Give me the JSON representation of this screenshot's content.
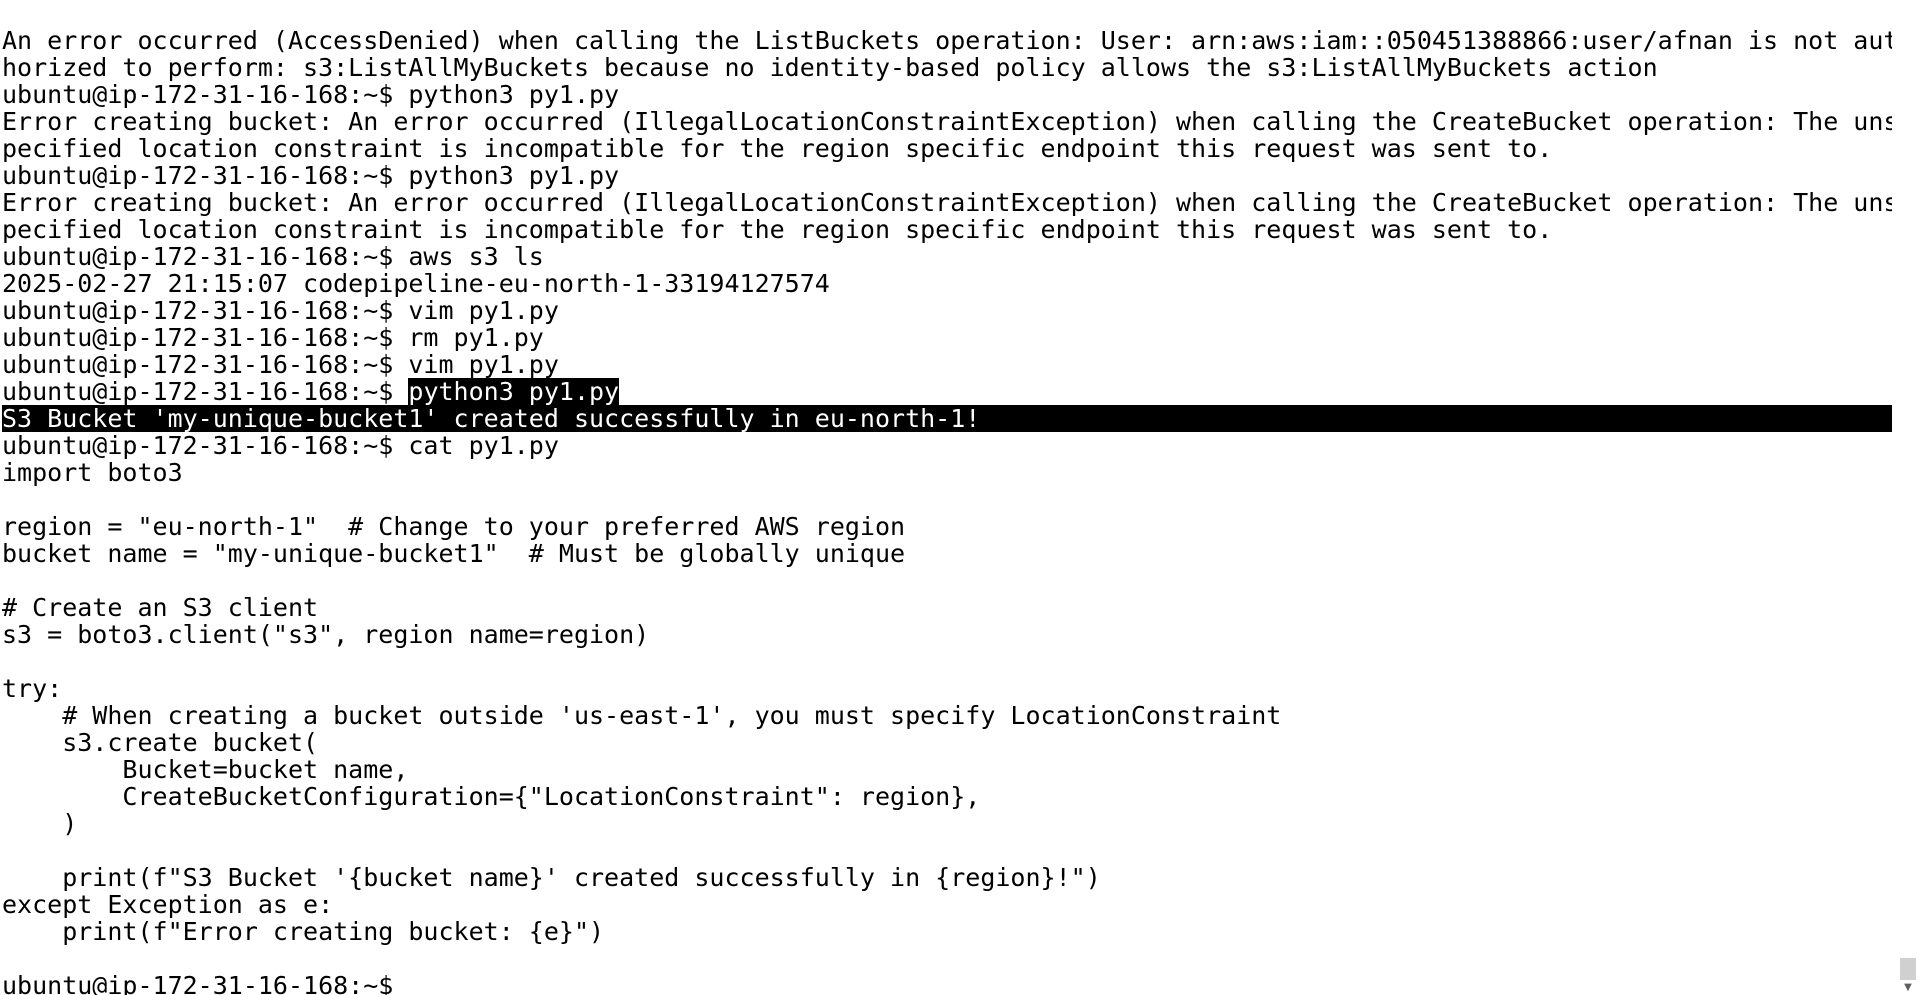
{
  "terminal": {
    "lines": [
      "An error occurred (AccessDenied) when calling the ListBuckets operation: User: arn:aws:iam::050451388866:user/afnan is not aut",
      "horized to perform: s3:ListAllMyBuckets because no identity-based policy allows the s3:ListAllMyBuckets action",
      "ubuntu@ip-172-31-16-168:~$ python3 py1.py",
      "Error creating bucket: An error occurred (IllegalLocationConstraintException) when calling the CreateBucket operation: The uns",
      "pecified location constraint is incompatible for the region specific endpoint this request was sent to.",
      "ubuntu@ip-172-31-16-168:~$ python3 py1.py",
      "Error creating bucket: An error occurred (IllegalLocationConstraintException) when calling the CreateBucket operation: The uns",
      "pecified location constraint is incompatible for the region specific endpoint this request was sent to.",
      "ubuntu@ip-172-31-16-168:~$ aws s3 ls",
      "2025-02-27 21:15:07 codepipeline-eu-north-1-33194127574",
      "ubuntu@ip-172-31-16-168:~$ vim py1.py",
      "ubuntu@ip-172-31-16-168:~$ rm py1.py",
      "ubuntu@ip-172-31-16-168:~$ vim py1.py"
    ],
    "selected_prompt": "ubuntu@ip-172-31-16-168:~$ ",
    "selected_command": "python3 py1.py",
    "selected_output": "S3 Bucket 'my-unique-bucket1' created successfully in eu-north-1!",
    "lines_after": [
      "ubuntu@ip-172-31-16-168:~$ cat py1.py",
      "import boto3",
      "",
      "region = \"eu-north-1\"  # Change to your preferred AWS region",
      "bucket_name = \"my-unique-bucket1\"  # Must be globally unique",
      "",
      "# Create an S3 client",
      "s3 = boto3.client(\"s3\", region_name=region)",
      "",
      "try:",
      "    # When creating a bucket outside 'us-east-1', you must specify LocationConstraint",
      "    s3.create_bucket(",
      "        Bucket=bucket_name,",
      "        CreateBucketConfiguration={\"LocationConstraint\": region},",
      "    )",
      "",
      "    print(f\"S3 Bucket '{bucket_name}' created successfully in {region}!\")",
      "except Exception as e:",
      "    print(f\"Error creating bucket: {e}\")",
      "",
      "ubuntu@ip-172-31-16-168:~$ "
    ]
  }
}
